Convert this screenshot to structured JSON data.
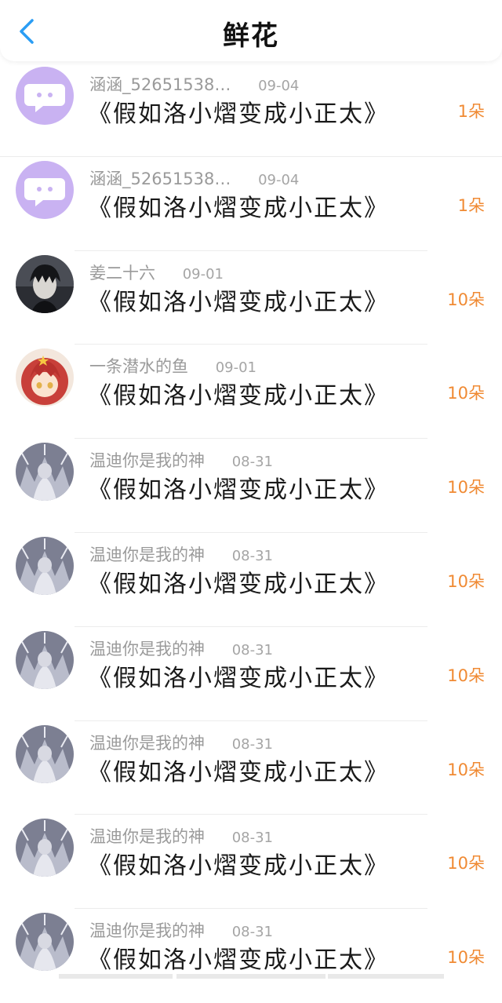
{
  "header": {
    "title": "鲜花",
    "back_icon": "chevron-left-icon",
    "accent": "#2a9df4"
  },
  "colors": {
    "count": "#f08a33",
    "meta": "#9a9a9a"
  },
  "rows": [
    {
      "name": "涵涵_52651538…",
      "date": "09-04",
      "book": "《假如洛小熠变成小正太》",
      "count": "1朵",
      "avatar": "chat-bubble-avatar"
    },
    {
      "name": "涵涵_52651538…",
      "date": "09-04",
      "book": "《假如洛小熠变成小正太》",
      "count": "1朵",
      "avatar": "chat-bubble-avatar"
    },
    {
      "name": "姜二十六",
      "date": "09-01",
      "book": "《假如洛小熠变成小正太》",
      "count": "10朵",
      "avatar": "dark-hair-boy-avatar"
    },
    {
      "name": "一条潜水的鱼",
      "date": "09-01",
      "book": "《假如洛小熠变成小正太》",
      "count": "10朵",
      "avatar": "red-hair-girl-avatar"
    },
    {
      "name": "温迪你是我的神",
      "date": "08-31",
      "book": "《假如洛小熠变成小正太》",
      "count": "10朵",
      "avatar": "grey-anime-avatar"
    },
    {
      "name": "温迪你是我的神",
      "date": "08-31",
      "book": "《假如洛小熠变成小正太》",
      "count": "10朵",
      "avatar": "grey-anime-avatar"
    },
    {
      "name": "温迪你是我的神",
      "date": "08-31",
      "book": "《假如洛小熠变成小正太》",
      "count": "10朵",
      "avatar": "grey-anime-avatar"
    },
    {
      "name": "温迪你是我的神",
      "date": "08-31",
      "book": "《假如洛小熠变成小正太》",
      "count": "10朵",
      "avatar": "grey-anime-avatar"
    },
    {
      "name": "温迪你是我的神",
      "date": "08-31",
      "book": "《假如洛小熠变成小正太》",
      "count": "10朵",
      "avatar": "grey-anime-avatar"
    },
    {
      "name": "温迪你是我的神",
      "date": "08-31",
      "book": "《假如洛小熠变成小正太》",
      "count": "10朵",
      "avatar": "grey-anime-avatar"
    }
  ]
}
